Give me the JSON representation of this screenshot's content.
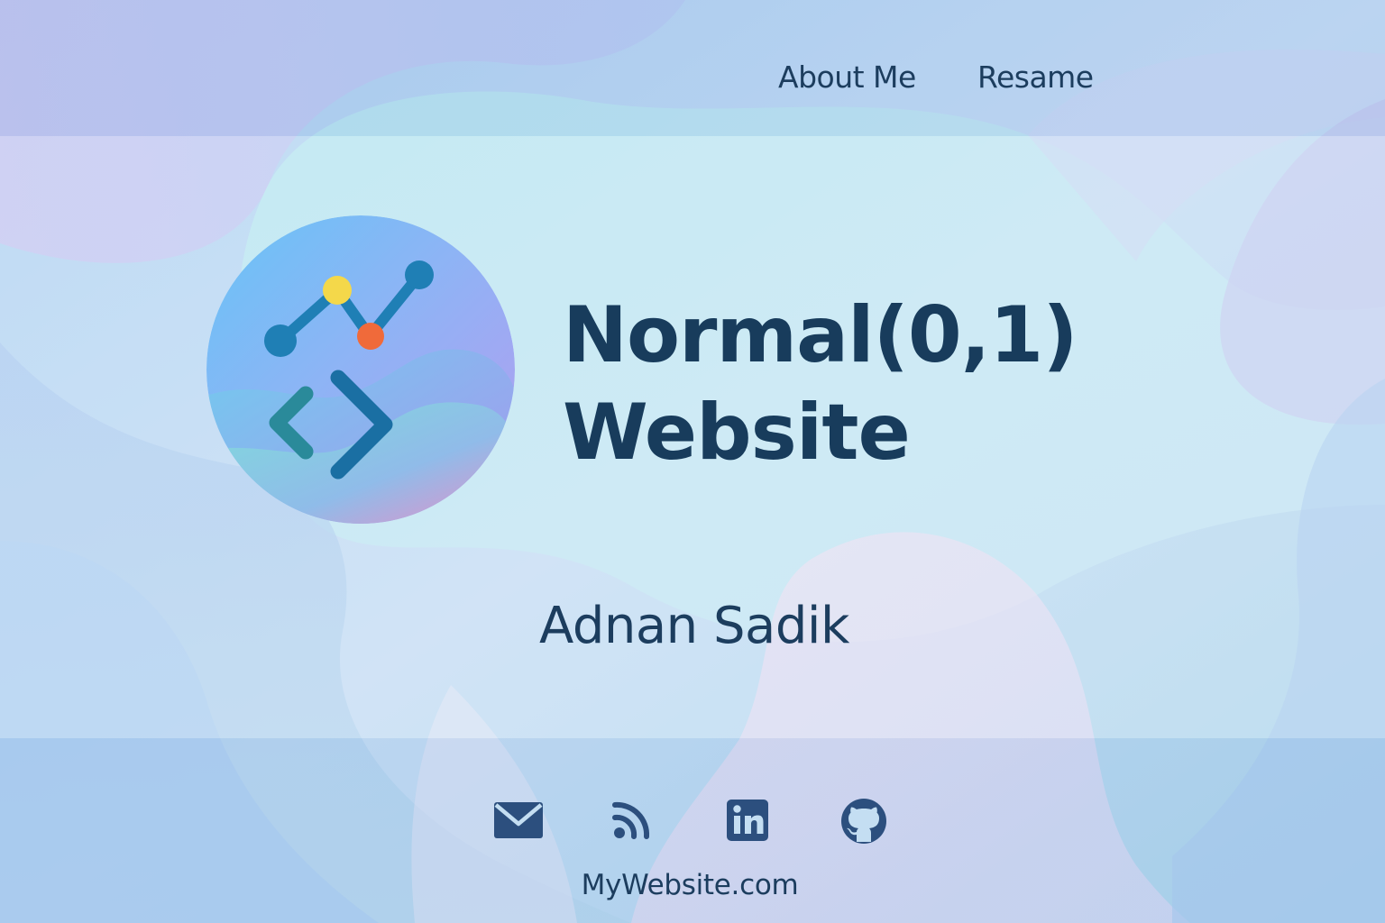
{
  "nav": {
    "items": [
      {
        "label": "About Me"
      },
      {
        "label": "Resame"
      }
    ]
  },
  "hero": {
    "title_line1": "Normal(0,1)",
    "title_line2": "Website",
    "author": "Adnan Sadik",
    "logo_icons": [
      "line-chart-icon",
      "code-brackets-icon"
    ]
  },
  "footer": {
    "social": [
      {
        "icon": "mail-icon"
      },
      {
        "icon": "rss-icon"
      },
      {
        "icon": "linkedin-icon"
      },
      {
        "icon": "github-icon"
      }
    ],
    "url": "MyWebsite.com"
  },
  "colors": {
    "text": "#1c3d5e",
    "icon": "#2c4f7e",
    "chart_line": "#1f7fb5",
    "dot_yellow": "#f4d84a",
    "dot_orange": "#f06a3a",
    "brackets": "#1a6fa3"
  }
}
